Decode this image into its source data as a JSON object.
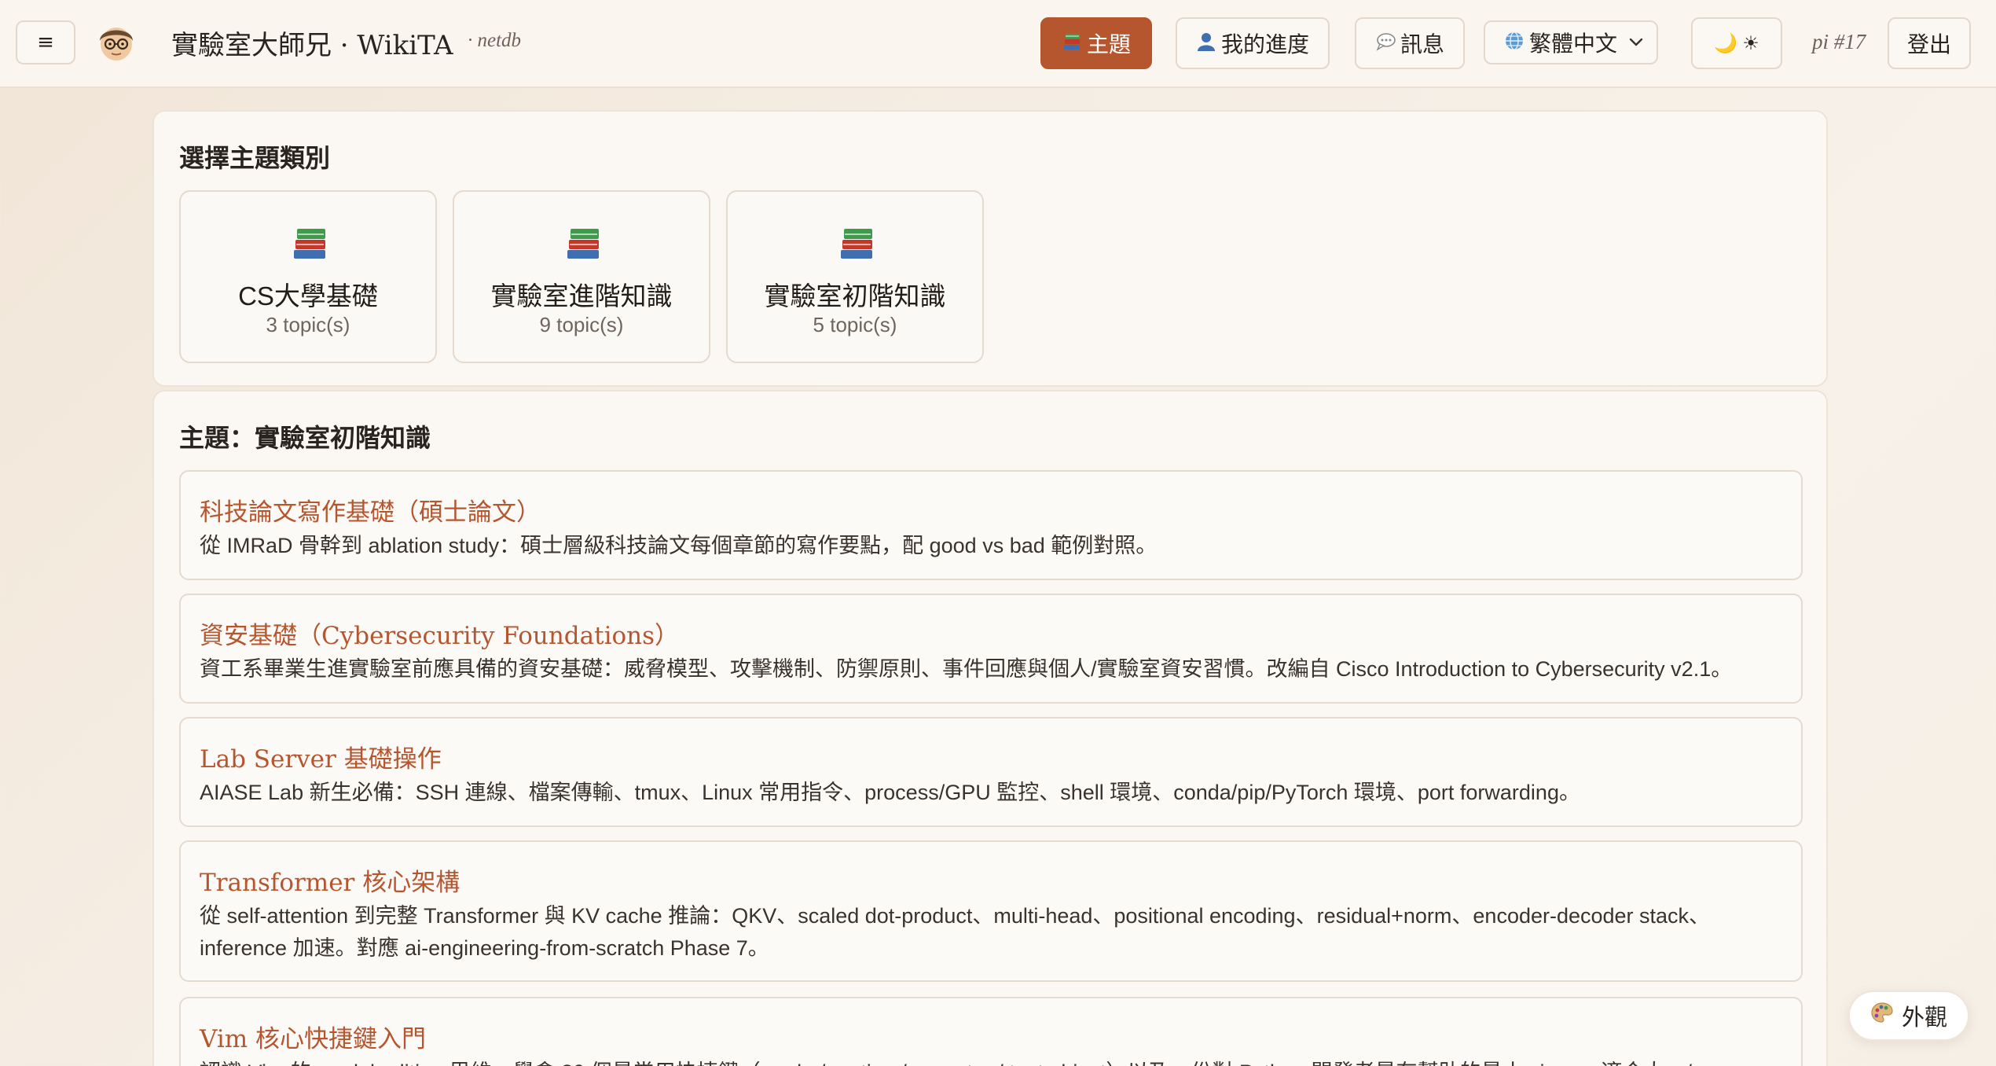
{
  "header": {
    "site_title": "實驗室大師兄 · WikiTA",
    "course": "· netdb",
    "nav": {
      "topics_label": "主題",
      "progress_label": "我的進度",
      "messages_label": "訊息",
      "language_label": "繁體中文",
      "theme_dark_glyph": "🌙",
      "theme_light_glyph": "☀",
      "user_label": "pi #17",
      "logout_label": "登出"
    },
    "menu_glyph": "≡",
    "icons": {
      "topics": "books-icon",
      "progress": "person-icon",
      "messages": "speech-bubble-icon",
      "language": "globe-icon",
      "language_dropdown": "chevron-down-icon"
    }
  },
  "categories": {
    "heading": "選擇主題類別",
    "items": [
      {
        "name": "CS大學基礎",
        "count": "3 topic(s)",
        "icon": "books-icon"
      },
      {
        "name": "實驗室進階知識",
        "count": "9 topic(s)",
        "icon": "books-icon"
      },
      {
        "name": "實驗室初階知識",
        "count": "5 topic(s)",
        "icon": "books-icon"
      }
    ]
  },
  "topics": {
    "heading": "主題：實驗室初階知識",
    "items": [
      {
        "title": "科技論文寫作基礎（碩士論文）",
        "description": "從 IMRaD 骨幹到 ablation study：碩士層級科技論文每個章節的寫作要點，配 good vs bad 範例對照。"
      },
      {
        "title": "資安基礎（Cybersecurity Foundations）",
        "description": "資工系畢業生進實驗室前應具備的資安基礎：威脅模型、攻擊機制、防禦原則、事件回應與個人/實驗室資安習慣。改編自 Cisco Introduction to Cybersecurity v2.1。"
      },
      {
        "title": "Lab Server 基礎操作",
        "description": "AIASE Lab 新生必備：SSH 連線、檔案傳輸、tmux、Linux 常用指令、process/GPU 監控、shell 環境、conda/pip/PyTorch 環境、port forwarding。"
      },
      {
        "title": "Transformer 核心架構",
        "description": "從 self-attention 到完整 Transformer 與 KV cache 推論：QKV、scaled dot-product、multi-head、positional encoding、residual+norm、encoder-decoder stack、inference 加速。對應 ai-engineering-from-scratch Phase 7。"
      },
      {
        "title": "Vim 核心快捷鍵入門",
        "description": "認識 Vim 的 modal editing 思維，學會 30 個最常用快捷鍵（mode / motion / operator / text object）以及一份對 Python 開發者最有幫助的最小 vimrc。適合大一/"
      }
    ]
  },
  "appearance": {
    "label": "外觀",
    "icon": "palette-icon"
  },
  "colors": {
    "accent": "#b5562f",
    "background": "#f6efe6",
    "card": "#fbf8f4"
  }
}
